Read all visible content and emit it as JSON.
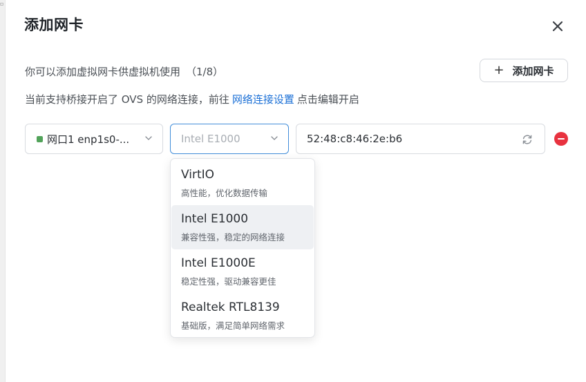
{
  "dialog": {
    "title": "添加网卡",
    "capacity_text": "你可以添加虚拟网卡供虚拟机使用",
    "capacity_count": "（1/8）",
    "add_button_label": "添加网卡",
    "support_text_before": "当前支持桥接开启了 OVS 的网络连接，前往",
    "support_link": "网络连接设置",
    "support_text_after": "点击编辑开启"
  },
  "nic_row": {
    "port_label": "网口1 enp1s0-...",
    "port_status_color": "#52a35a",
    "model_placeholder": "Intel E1000",
    "mac_value": "52:48:c8:46:2e:b6"
  },
  "dropdown": {
    "selected_index": 1,
    "options": [
      {
        "name": "VirtIO",
        "desc": "高性能，优化数据传输"
      },
      {
        "name": "Intel E1000",
        "desc": "兼容性强，稳定的网络连接"
      },
      {
        "name": "Intel E1000E",
        "desc": "稳定性强，驱动兼容更佳"
      },
      {
        "name": "Realtek RTL8139",
        "desc": "基础版，满足简单网络需求"
      }
    ]
  },
  "colors": {
    "link": "#1a6fd6",
    "focus_border": "#3f8cd9",
    "danger": "#e8323f"
  },
  "icons": {
    "close": "close-icon",
    "plus": "plus-icon",
    "chevron": "chevron-down-icon",
    "refresh": "refresh-icon",
    "remove": "remove-circle-icon"
  }
}
